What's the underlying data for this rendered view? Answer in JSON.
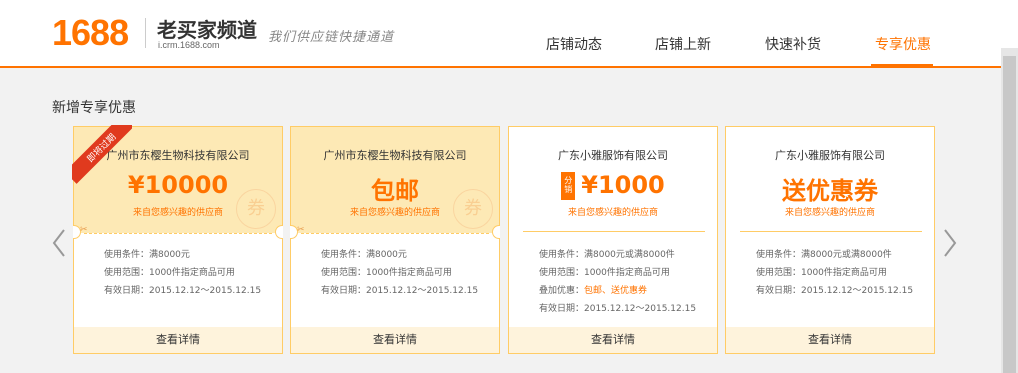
{
  "header": {
    "logo": "1688",
    "title": "老买家频道",
    "url": "i.crm.1688.com",
    "slogan": "我们供应链快捷通道",
    "nav": [
      {
        "label": "店铺动态",
        "active": false
      },
      {
        "label": "店铺上新",
        "active": false
      },
      {
        "label": "快速补货",
        "active": false
      },
      {
        "label": "专享优惠",
        "active": true
      }
    ]
  },
  "section": {
    "title": "新增专享优惠"
  },
  "cards": [
    {
      "company": "广州市东樱生物科技有限公司",
      "amount": "¥10000",
      "badge": "即将过期",
      "from": "来自您感兴趣的供应商",
      "stamp": "券",
      "lines": [
        "使用条件：满8000元",
        "使用范围：1000件指定商品可用",
        "有效日期：2015.12.12～2015.12.15"
      ],
      "action": "查看详情"
    },
    {
      "company": "广州市东樱生物科技有限公司",
      "amount": "包邮",
      "from": "来自您感兴趣的供应商",
      "stamp": "券",
      "lines": [
        "使用条件：满8000元",
        "使用范围：1000件指定商品可用",
        "有效日期：2015.12.12～2015.12.15"
      ],
      "action": "查看详情"
    },
    {
      "company": "广东小雅服饰有限公司",
      "amount": "¥1000",
      "tag": "分销",
      "from": "来自您感兴趣的供应商",
      "lines": [
        "使用条件：满8000元或满8000件",
        "使用范围：1000件指定商品可用"
      ],
      "extra_label": "叠加优惠：",
      "extra_value": "包邮、送优惠券",
      "last_line": "有效日期：2015.12.12～2015.12.15",
      "action": "查看详情"
    },
    {
      "company": "广东小雅服饰有限公司",
      "amount": "送优惠券",
      "from": "来自您感兴趣的供应商",
      "lines": [
        "使用条件：满8000元或满8000件",
        "使用范围：1000件指定商品可用",
        "有效日期：2015.12.12～2015.12.15"
      ],
      "action": "查看详情"
    }
  ],
  "colors": {
    "accent": "#ff7300",
    "card_border": "#ffcc66",
    "card_fill": "#fde9b5",
    "badge": "#e03a1e"
  }
}
